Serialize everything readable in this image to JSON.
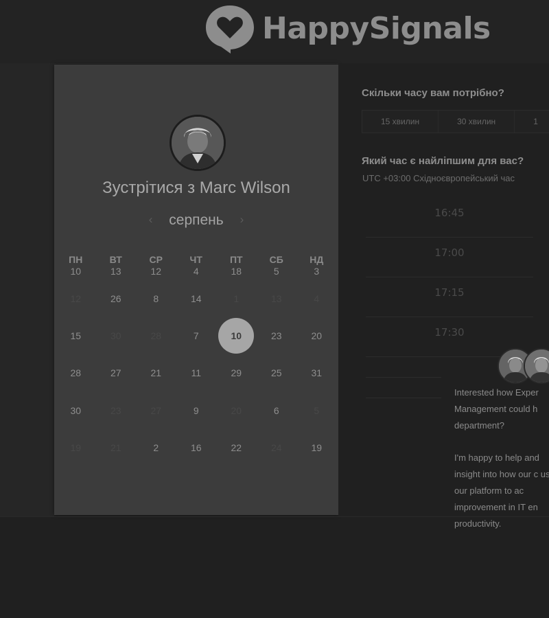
{
  "brand": {
    "name": "HappySignals"
  },
  "calendar": {
    "title": "Зустрітися з Marc Wilson",
    "month": "серпень",
    "prev_arrow": "‹",
    "next_arrow": "›",
    "weekdays": [
      "ПН",
      "ВТ",
      "СР",
      "ЧТ",
      "ПТ",
      "СБ",
      "НД"
    ],
    "weeks": [
      [
        {
          "d": "10",
          "dim": false
        },
        {
          "d": "13",
          "dim": false
        },
        {
          "d": "12",
          "dim": false
        },
        {
          "d": "4",
          "dim": false
        },
        {
          "d": "18",
          "dim": false
        },
        {
          "d": "5",
          "dim": false
        },
        {
          "d": "3",
          "dim": false
        }
      ],
      [
        {
          "d": "12",
          "dim": true
        },
        {
          "d": "26",
          "dim": false
        },
        {
          "d": "8",
          "dim": false
        },
        {
          "d": "14",
          "dim": false
        },
        {
          "d": "1",
          "dim": true
        },
        {
          "d": "13",
          "dim": true
        },
        {
          "d": "4",
          "dim": true
        }
      ],
      [
        {
          "d": "15",
          "dim": false
        },
        {
          "d": "30",
          "dim": true
        },
        {
          "d": "28",
          "dim": true
        },
        {
          "d": "7",
          "dim": false
        },
        {
          "d": "10",
          "dim": false,
          "selected": true
        },
        {
          "d": "23",
          "dim": false
        },
        {
          "d": "20",
          "dim": false
        }
      ],
      [
        {
          "d": "28",
          "dim": false
        },
        {
          "d": "27",
          "dim": false
        },
        {
          "d": "21",
          "dim": false
        },
        {
          "d": "11",
          "dim": false
        },
        {
          "d": "29",
          "dim": false
        },
        {
          "d": "25",
          "dim": false
        },
        {
          "d": "31",
          "dim": false
        }
      ],
      [
        {
          "d": "30",
          "dim": false
        },
        {
          "d": "23",
          "dim": true
        },
        {
          "d": "27",
          "dim": true
        },
        {
          "d": "9",
          "dim": false
        },
        {
          "d": "20",
          "dim": true
        },
        {
          "d": "6",
          "dim": false
        },
        {
          "d": "5",
          "dim": true
        }
      ],
      [
        {
          "d": "19",
          "dim": true
        },
        {
          "d": "21",
          "dim": true
        },
        {
          "d": "2",
          "dim": false
        },
        {
          "d": "16",
          "dim": false
        },
        {
          "d": "22",
          "dim": false
        },
        {
          "d": "24",
          "dim": true
        },
        {
          "d": "19",
          "dim": false
        }
      ]
    ]
  },
  "duration": {
    "question": "Скільки часу вам потрібно?",
    "options": [
      "15 хвилин",
      "30 хвилин",
      "1"
    ]
  },
  "time": {
    "question": "Який час є найліпшим для вас?",
    "timezone": "UTC +03:00 Східноєвропейський час",
    "slots": [
      "16:45",
      "17:00",
      "17:15",
      "17:30"
    ]
  },
  "chat": {
    "message1": "Interested how Exper Management could h department?",
    "message2": "I'm happy to help and insight into how our c use our platform to ac improvement in IT en productivity."
  },
  "colors": {
    "background": "#202020",
    "card": "#3c3c3c",
    "selected_day": "#a6a6a6",
    "logo": "#8d8d8d"
  }
}
